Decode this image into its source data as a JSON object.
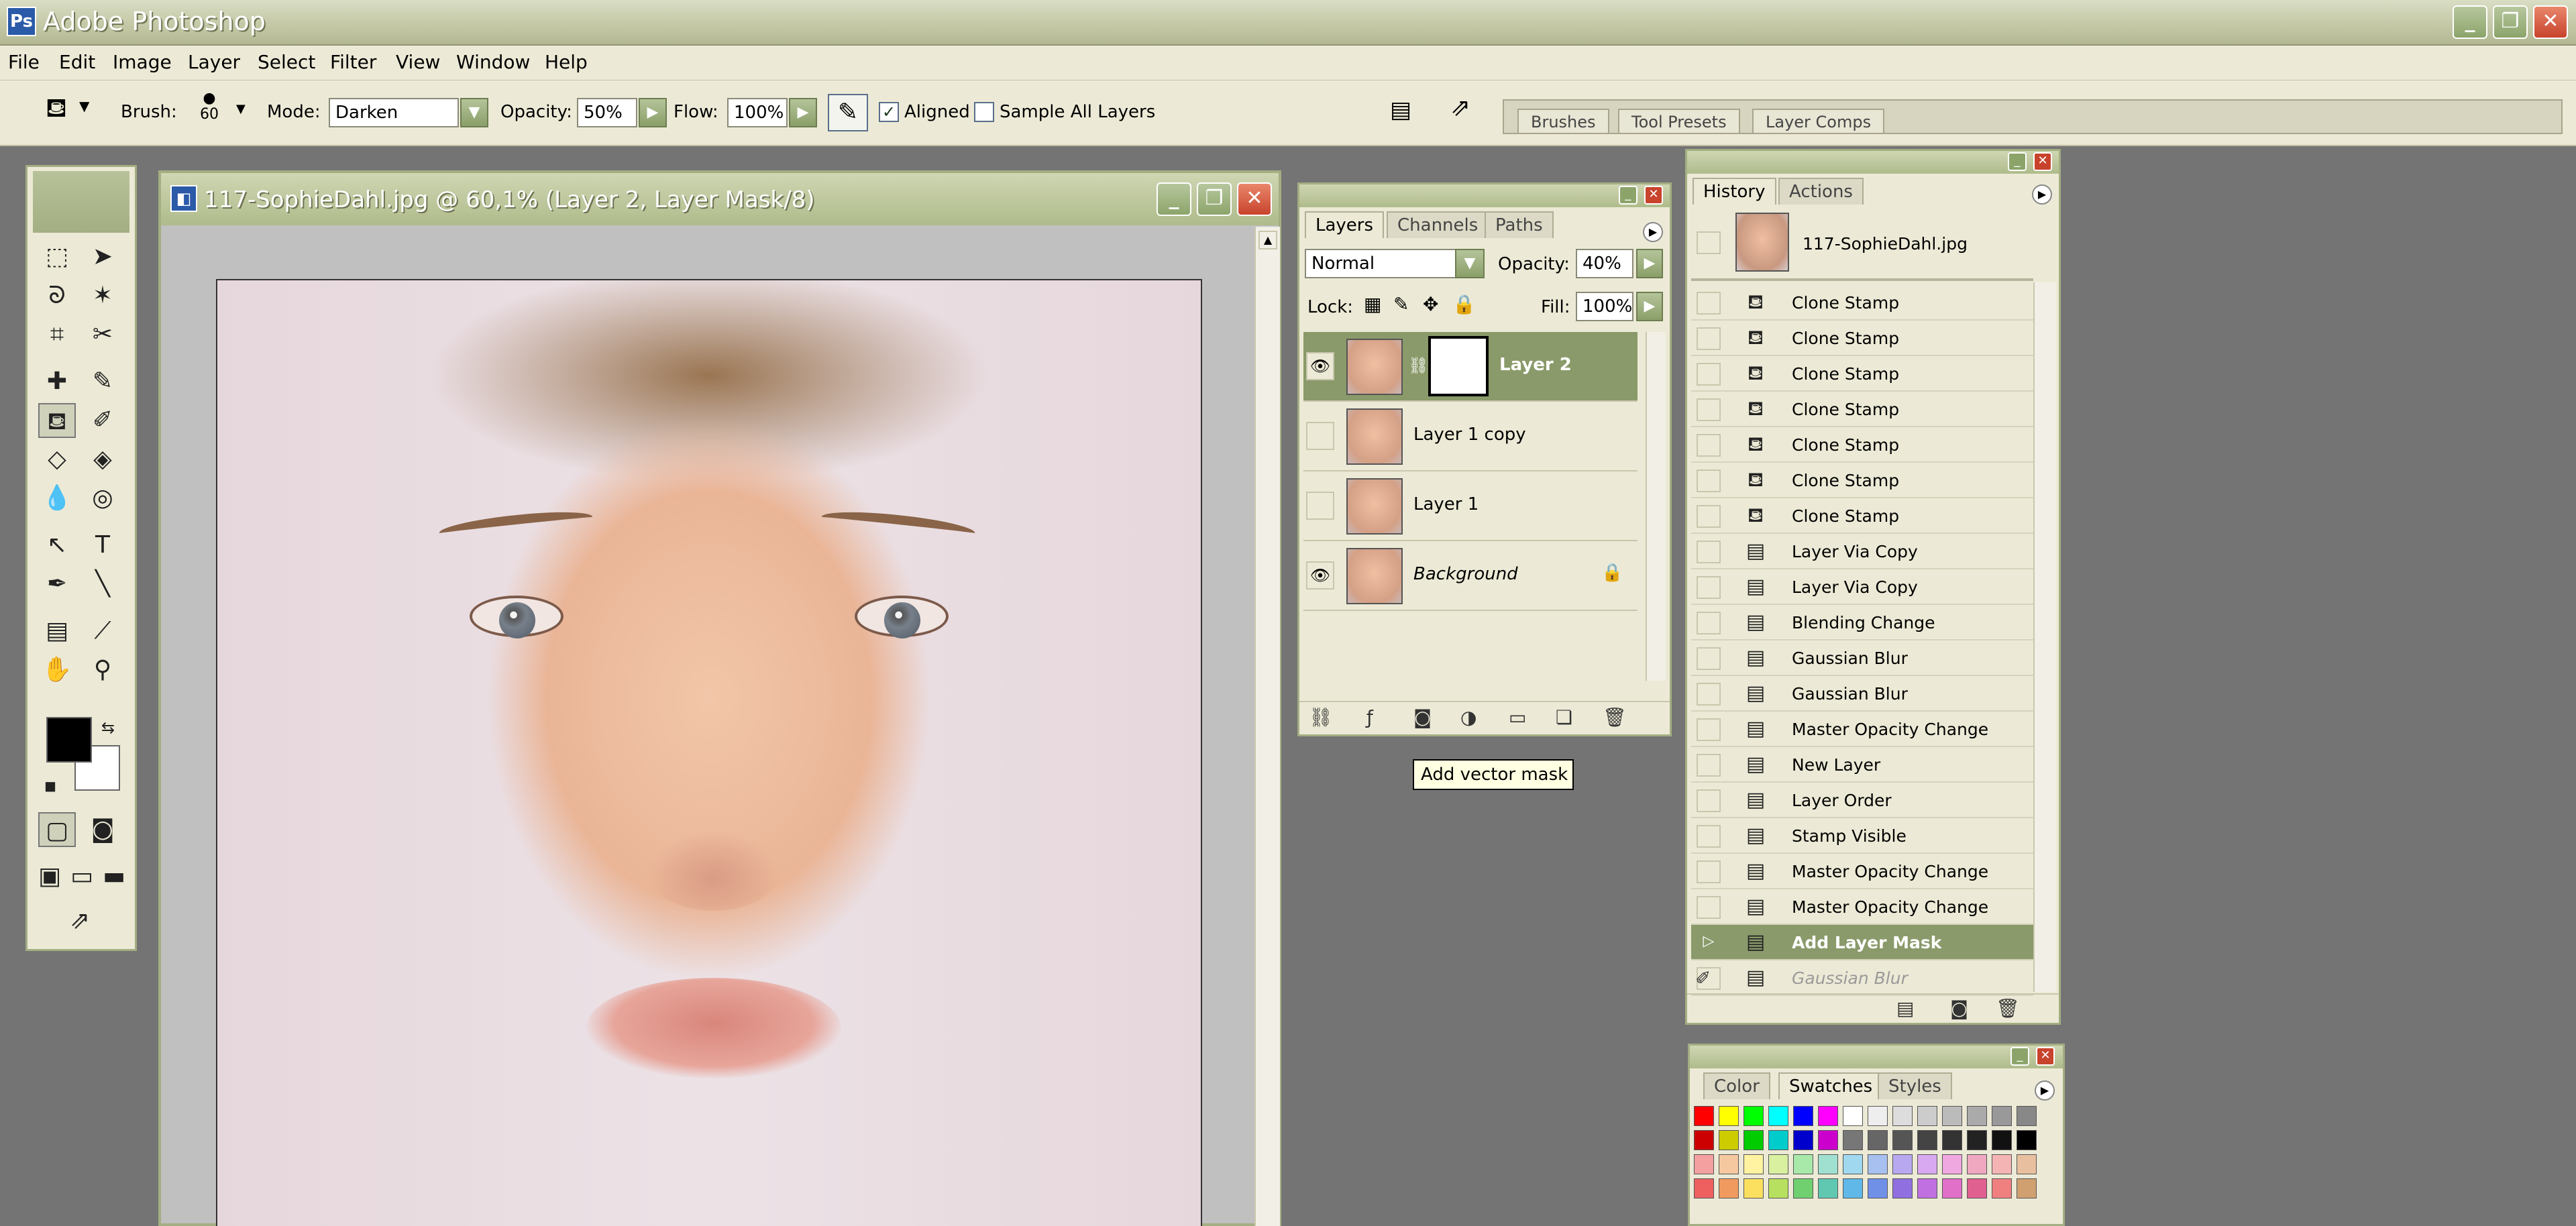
{
  "app": {
    "title": "Adobe Photoshop",
    "icon_letter": "Ps"
  },
  "window_controls": {
    "minimize": "_",
    "restore": "❐",
    "close": "✕"
  },
  "menu": [
    "File",
    "Edit",
    "Image",
    "Layer",
    "Select",
    "Filter",
    "View",
    "Window",
    "Help"
  ],
  "options_bar": {
    "brush_label": "Brush:",
    "brush_size": "60",
    "mode_label": "Mode:",
    "mode_value": "Darken",
    "opacity_label": "Opacity:",
    "opacity_value": "50%",
    "flow_label": "Flow:",
    "flow_value": "100%",
    "aligned_label": "Aligned",
    "aligned_checked": true,
    "sample_all_label": "Sample All Layers",
    "sample_all_checked": false
  },
  "palette_well": {
    "tabs": [
      "Brushes",
      "Tool Presets",
      "Layer Comps"
    ]
  },
  "document": {
    "title": "117-SophieDahl.jpg @ 60,1% (Layer 2, Layer Mask/8)"
  },
  "layers_panel": {
    "tabs": [
      "Layers",
      "Channels",
      "Paths"
    ],
    "blend_mode": "Normal",
    "opacity_label": "Opacity:",
    "opacity_value": "40%",
    "lock_label": "Lock:",
    "fill_label": "Fill:",
    "fill_value": "100%",
    "layers": [
      {
        "name": "Layer 2",
        "visible": true,
        "selected": true,
        "has_mask": true
      },
      {
        "name": "Layer 1 copy",
        "visible": false,
        "selected": false
      },
      {
        "name": "Layer 1",
        "visible": false,
        "selected": false
      },
      {
        "name": "Background",
        "visible": true,
        "selected": false,
        "locked": true
      }
    ]
  },
  "tooltip": {
    "text": "Add vector mask"
  },
  "history_panel": {
    "tabs": [
      "History",
      "Actions"
    ],
    "snapshot": "117-SophieDahl.jpg",
    "states": [
      "Clone Stamp",
      "Clone Stamp",
      "Clone Stamp",
      "Clone Stamp",
      "Clone Stamp",
      "Clone Stamp",
      "Clone Stamp",
      "Layer Via Copy",
      "Layer Via Copy",
      "Blending Change",
      "Gaussian Blur",
      "Gaussian Blur",
      "Master Opacity Change",
      "New Layer",
      "Layer Order",
      "Stamp Visible",
      "Master Opacity Change",
      "Master Opacity Change",
      "Add Layer Mask",
      "Gaussian Blur"
    ],
    "selected_index": 18
  },
  "swatches_panel": {
    "tabs": [
      "Color",
      "Swatches",
      "Styles"
    ],
    "row1": [
      "#ff0000",
      "#ffff00",
      "#00ff00",
      "#00ffff",
      "#0000ff",
      "#ff00ff",
      "#ffffff",
      "#eeeeee",
      "#dddddd",
      "#cccccc",
      "#bbbbbb",
      "#aaaaaa",
      "#999999",
      "#888888"
    ],
    "row2": [
      "#cc0000",
      "#cccc00",
      "#00cc00",
      "#00cccc",
      "#0000cc",
      "#cc00cc",
      "#777777",
      "#666666",
      "#555555",
      "#444444",
      "#333333",
      "#222222",
      "#111111",
      "#000000"
    ],
    "row3": [
      "#f4a0a0",
      "#f6c8a0",
      "#fff2a0",
      "#d8f0a0",
      "#a8e8a8",
      "#a0e0d0",
      "#a0d8f0",
      "#a8c0f0",
      "#b8a8f0",
      "#d8a8f0",
      "#f0a8e0",
      "#f0a8c0",
      "#f4b4b4",
      "#e8c0a0"
    ],
    "row4": [
      "#ee6060",
      "#f09a60",
      "#fbe060",
      "#b8e060",
      "#70d070",
      "#60c8b0",
      "#60b8e8",
      "#7090e8",
      "#9070e0",
      "#c070e0",
      "#e070c8",
      "#e06090",
      "#f08080",
      "#d0a070"
    ]
  },
  "colors": {
    "accent": "#8a9a6a",
    "panel_bg": "#ecead6",
    "border": "#a3ae82",
    "foreground_color": "#000000",
    "background_color": "#ffffff"
  }
}
